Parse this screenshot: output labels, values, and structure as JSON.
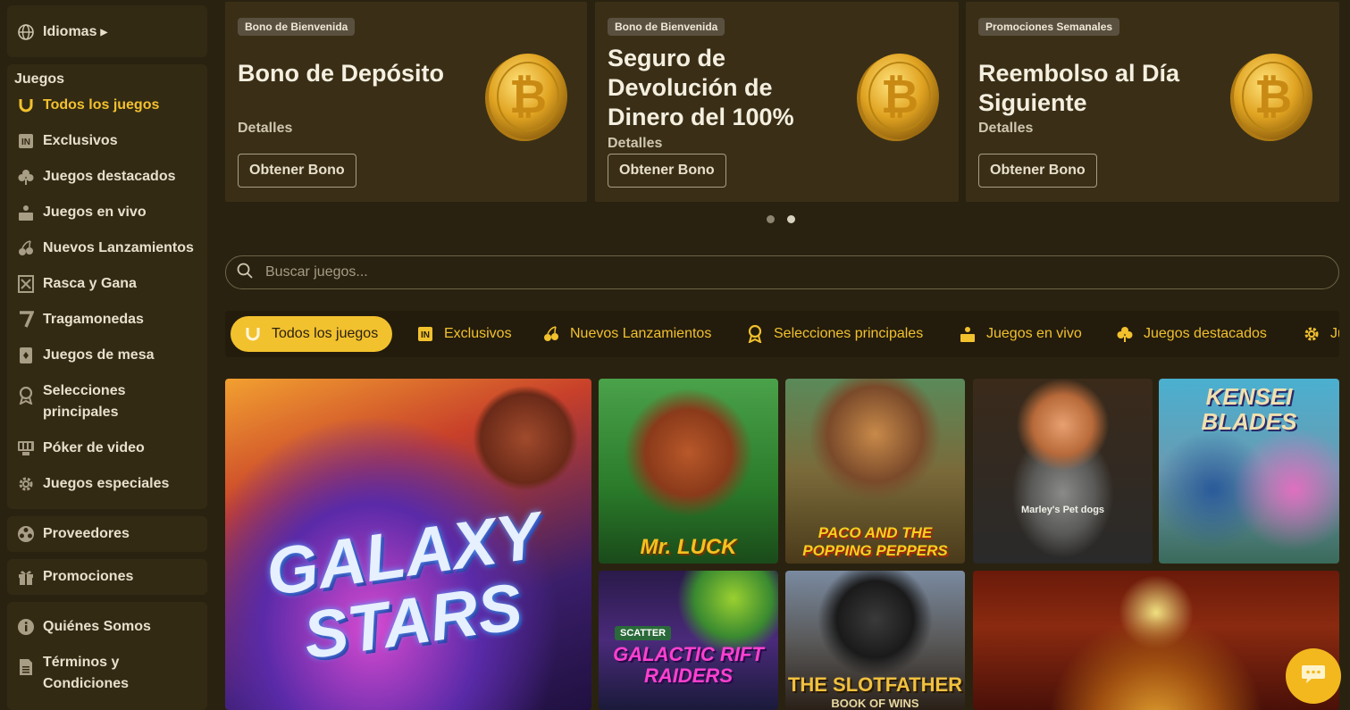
{
  "sidebar": {
    "language_label": "Idiomas",
    "games_heading": "Juegos",
    "items": [
      {
        "label": "Todos los juegos",
        "icon": "horseshoe-icon"
      },
      {
        "label": "Exclusivos",
        "icon": "exclusive-icon"
      },
      {
        "label": "Juegos destacados",
        "icon": "clover-icon"
      },
      {
        "label": "Juegos en vivo",
        "icon": "live-dealer-icon"
      },
      {
        "label": "Nuevos Lanzamientos",
        "icon": "cherries-icon"
      },
      {
        "label": "Rasca y Gana",
        "icon": "scratch-card-icon"
      },
      {
        "label": "Tragamonedas",
        "icon": "seven-icon"
      },
      {
        "label": "Juegos de mesa",
        "icon": "card-icon"
      },
      {
        "label": "Selecciones principales",
        "icon": "award-icon"
      },
      {
        "label": "Póker de video",
        "icon": "video-poker-icon"
      },
      {
        "label": "Juegos especiales",
        "icon": "gear-icon"
      }
    ],
    "providers_label": "Proveedores",
    "promotions_label": "Promociones",
    "about_label": "Quiénes Somos",
    "terms_label": "Términos y Condiciones"
  },
  "banners": [
    {
      "tag": "Bono de Bienvenida",
      "title": "Bono de Depósito",
      "details": "Detalles",
      "button": "Obtener Bono"
    },
    {
      "tag": "Bono de Bienvenida",
      "title": "Seguro de Devolución de Dinero del 100%",
      "details": "Detalles",
      "button": "Obtener Bono"
    },
    {
      "tag": "Promociones Semanales",
      "title": "Reembolso al Día Siguiente",
      "details": "Detalles",
      "button": "Obtener Bono"
    }
  ],
  "carousel": {
    "pages": 2,
    "active_page": 2
  },
  "search": {
    "placeholder": "Buscar juegos..."
  },
  "category_tabs": [
    {
      "label": "Todos los juegos",
      "icon": "horseshoe-icon",
      "active": true
    },
    {
      "label": "Exclusivos",
      "icon": "exclusive-icon"
    },
    {
      "label": "Nuevos Lanzamientos",
      "icon": "cherries-icon"
    },
    {
      "label": "Selecciones principales",
      "icon": "award-icon"
    },
    {
      "label": "Juegos en vivo",
      "icon": "live-dealer-icon"
    },
    {
      "label": "Juegos destacados",
      "icon": "clover-icon"
    },
    {
      "label": "Ju",
      "icon": "gear-icon"
    }
  ],
  "games": [
    {
      "name": "GALAXY STARS"
    },
    {
      "name": "Mr. LUCK"
    },
    {
      "name": "PACO AND THE POPPING PEPPERS"
    },
    {
      "name": "Marley's Pet dogs"
    },
    {
      "name": "KENSEI BLADES"
    },
    {
      "name": "GALACTIC RIFT RAIDERS",
      "badge": "SCATTER"
    },
    {
      "name": "THE SLOTFATHER",
      "subtitle": "BOOK OF WINS"
    },
    {
      "name": ""
    }
  ],
  "colors": {
    "accent": "#f2c12e",
    "background": "#2a2210",
    "panel": "#332a14"
  }
}
